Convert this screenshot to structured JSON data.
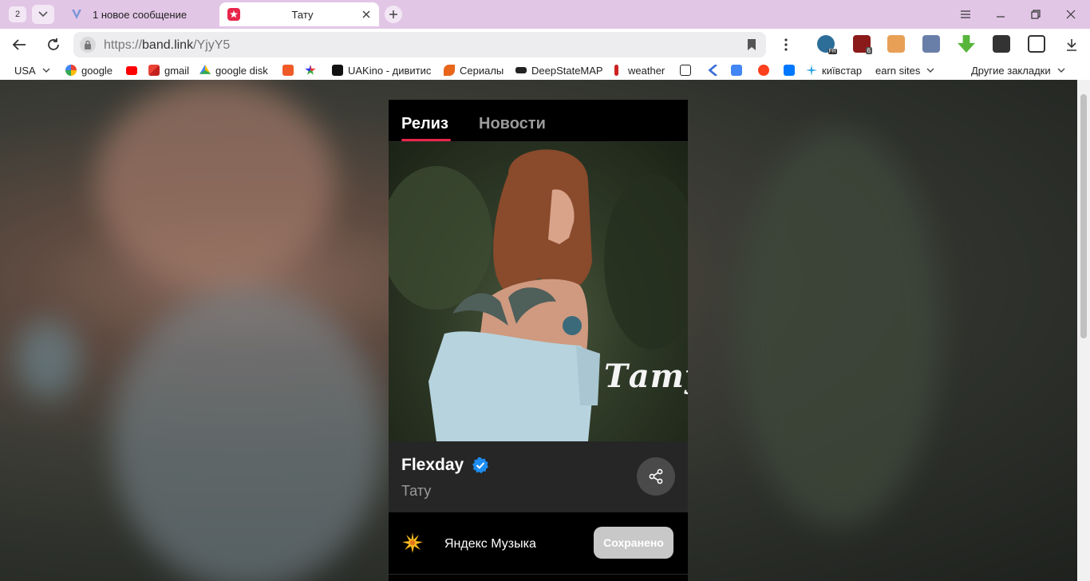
{
  "browser": {
    "tab_count": "2",
    "tabs": [
      {
        "title": "1 новое сообщение"
      },
      {
        "title": "Тату"
      }
    ],
    "address": {
      "scheme": "https://",
      "host": "band.link",
      "path": "/YjyY5"
    },
    "bookmarks": [
      {
        "label": "USA"
      },
      {
        "label": "google"
      },
      {
        "label": "gmail"
      },
      {
        "label": "google disk"
      },
      {
        "label": "UAKino - дивитис"
      },
      {
        "label": "Сериалы"
      },
      {
        "label": "DeepStateMAP"
      },
      {
        "label": "weather"
      },
      {
        "label": "київстар"
      },
      {
        "label": "earn sites"
      },
      {
        "label": "Другие закладки"
      }
    ],
    "extension_badges": {
      "fr": "FR",
      "ublock": "6"
    }
  },
  "page": {
    "tabs": [
      {
        "label": "Релиз"
      },
      {
        "label": "Новости"
      }
    ],
    "cover_title": "Tату",
    "artist": "Flexday",
    "release_title": "Тату",
    "services": [
      {
        "name": "Яндекс Музыка",
        "button": "Сохранено"
      }
    ]
  },
  "colors": {
    "accent": "#e8264a",
    "verified": "#1d8cf0",
    "tabstrip": "#e2c6e6"
  }
}
